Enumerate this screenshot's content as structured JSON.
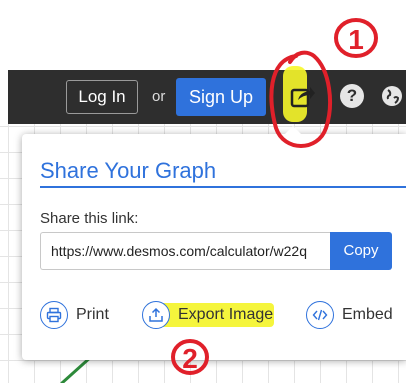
{
  "header": {
    "login_label": "Log In",
    "or_label": "or",
    "signup_label": "Sign Up",
    "help_label": "?"
  },
  "share_panel": {
    "title": "Share Your Graph",
    "link_label": "Share this link:",
    "link_value": "https://www.desmos.com/calculator/w22q",
    "copy_label": "Copy",
    "actions": [
      {
        "label": "Print",
        "icon": "printer-icon"
      },
      {
        "label": "Export Image",
        "icon": "upload-icon"
      },
      {
        "label": "Embed",
        "icon": "code-icon"
      }
    ]
  },
  "annotations": {
    "step_one": "1",
    "step_two": "2"
  },
  "colors": {
    "brand_blue": "#2f72dc",
    "header_dark": "#2e2e2e",
    "highlight_yellow": "#f7f72a",
    "annotation_red": "#e0202a",
    "graph_green": "#2d8a3a"
  }
}
